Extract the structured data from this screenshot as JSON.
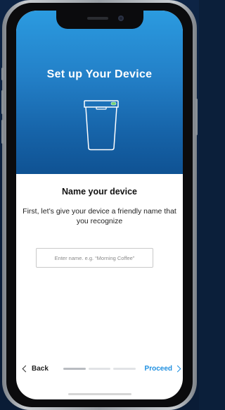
{
  "hero": {
    "title": "Set up Your Device",
    "icon": "trash-bin-device-icon",
    "gradient_top": "#2b9be0",
    "gradient_bottom": "#0f5293"
  },
  "content": {
    "title": "Name your device",
    "description": "First, let’s give your device a friendly name that you recognize"
  },
  "name_input": {
    "value": "",
    "placeholder": "Enter name. e.g. “Morning Coffee”"
  },
  "footer": {
    "back_label": "Back",
    "back_icon": "chevron-left-icon",
    "proceed_label": "Proceed",
    "proceed_icon": "chevron-right-icon",
    "accent_color": "#1e8fe0",
    "progress": {
      "current_step": 1,
      "total_steps": 3
    }
  }
}
